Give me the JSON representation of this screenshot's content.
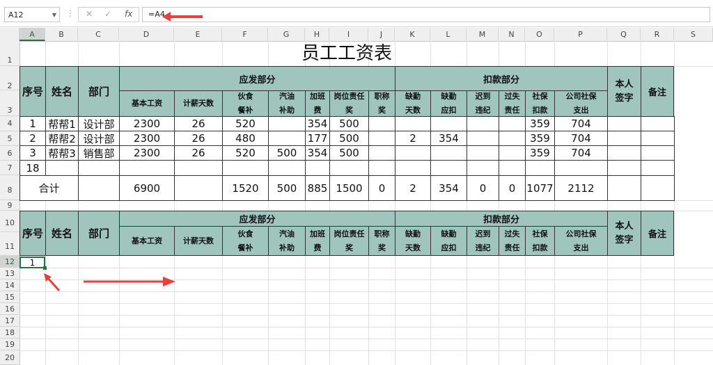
{
  "formula_bar": {
    "name_box": "A12",
    "formula": "=A4",
    "fx_label": "fx"
  },
  "columns": [
    "A",
    "B",
    "C",
    "D",
    "E",
    "F",
    "G",
    "H",
    "I",
    "J",
    "K",
    "L",
    "M",
    "N",
    "O",
    "P",
    "Q",
    "R",
    "S"
  ],
  "rows": [
    "1",
    "2",
    "3",
    "4",
    "5",
    "6",
    "7",
    "8",
    "9",
    "10",
    "11",
    "12",
    "13",
    "14",
    "15",
    "16",
    "17",
    "18",
    "19",
    "20"
  ],
  "title": "员工工资表",
  "headers": {
    "seq": "序号",
    "name": "姓名",
    "dept": "部门",
    "payable": "应发部分",
    "deduct": "扣款部分",
    "signature": "本人签字",
    "remark": "备注",
    "sub": [
      "基本工资",
      "计薪天数",
      "伙食餐补",
      "汽油补助",
      "加班费",
      "岗位责任奖",
      "职称奖",
      "缺勤天数",
      "缺勤应扣",
      "迟到违纪",
      "过失责任",
      "社保扣款",
      "公司社保支出"
    ]
  },
  "data_rows": [
    [
      "1",
      "帮帮1",
      "设计部",
      "2300",
      "26",
      "520",
      "",
      "354",
      "500",
      "",
      "",
      "",
      "",
      "",
      "359",
      "704",
      "",
      ""
    ],
    [
      "2",
      "帮帮2",
      "设计部",
      "2300",
      "26",
      "480",
      "",
      "177",
      "500",
      "",
      "2",
      "354",
      "",
      "",
      "359",
      "704",
      "",
      ""
    ],
    [
      "3",
      "帮帮3",
      "销售部",
      "2300",
      "26",
      "520",
      "500",
      "354",
      "500",
      "",
      "",
      "",
      "",
      "",
      "359",
      "704",
      "",
      ""
    ],
    [
      "18",
      "",
      "",
      "",
      "",
      "",
      "",
      "",
      "",
      "",
      "",
      "",
      "",
      "",
      "",
      "",
      "",
      ""
    ]
  ],
  "total_row": {
    "label": "合计",
    "values": [
      "6900",
      "",
      "1520",
      "500",
      "885",
      "1500",
      "0",
      "2",
      "354",
      "0",
      "0",
      "1077",
      "2112"
    ]
  },
  "selected_cell_value": "1",
  "accent_colors": {
    "header_fill": "#9fc5bc",
    "selection": "#217346",
    "annotation_arrow": "#e8413c"
  }
}
